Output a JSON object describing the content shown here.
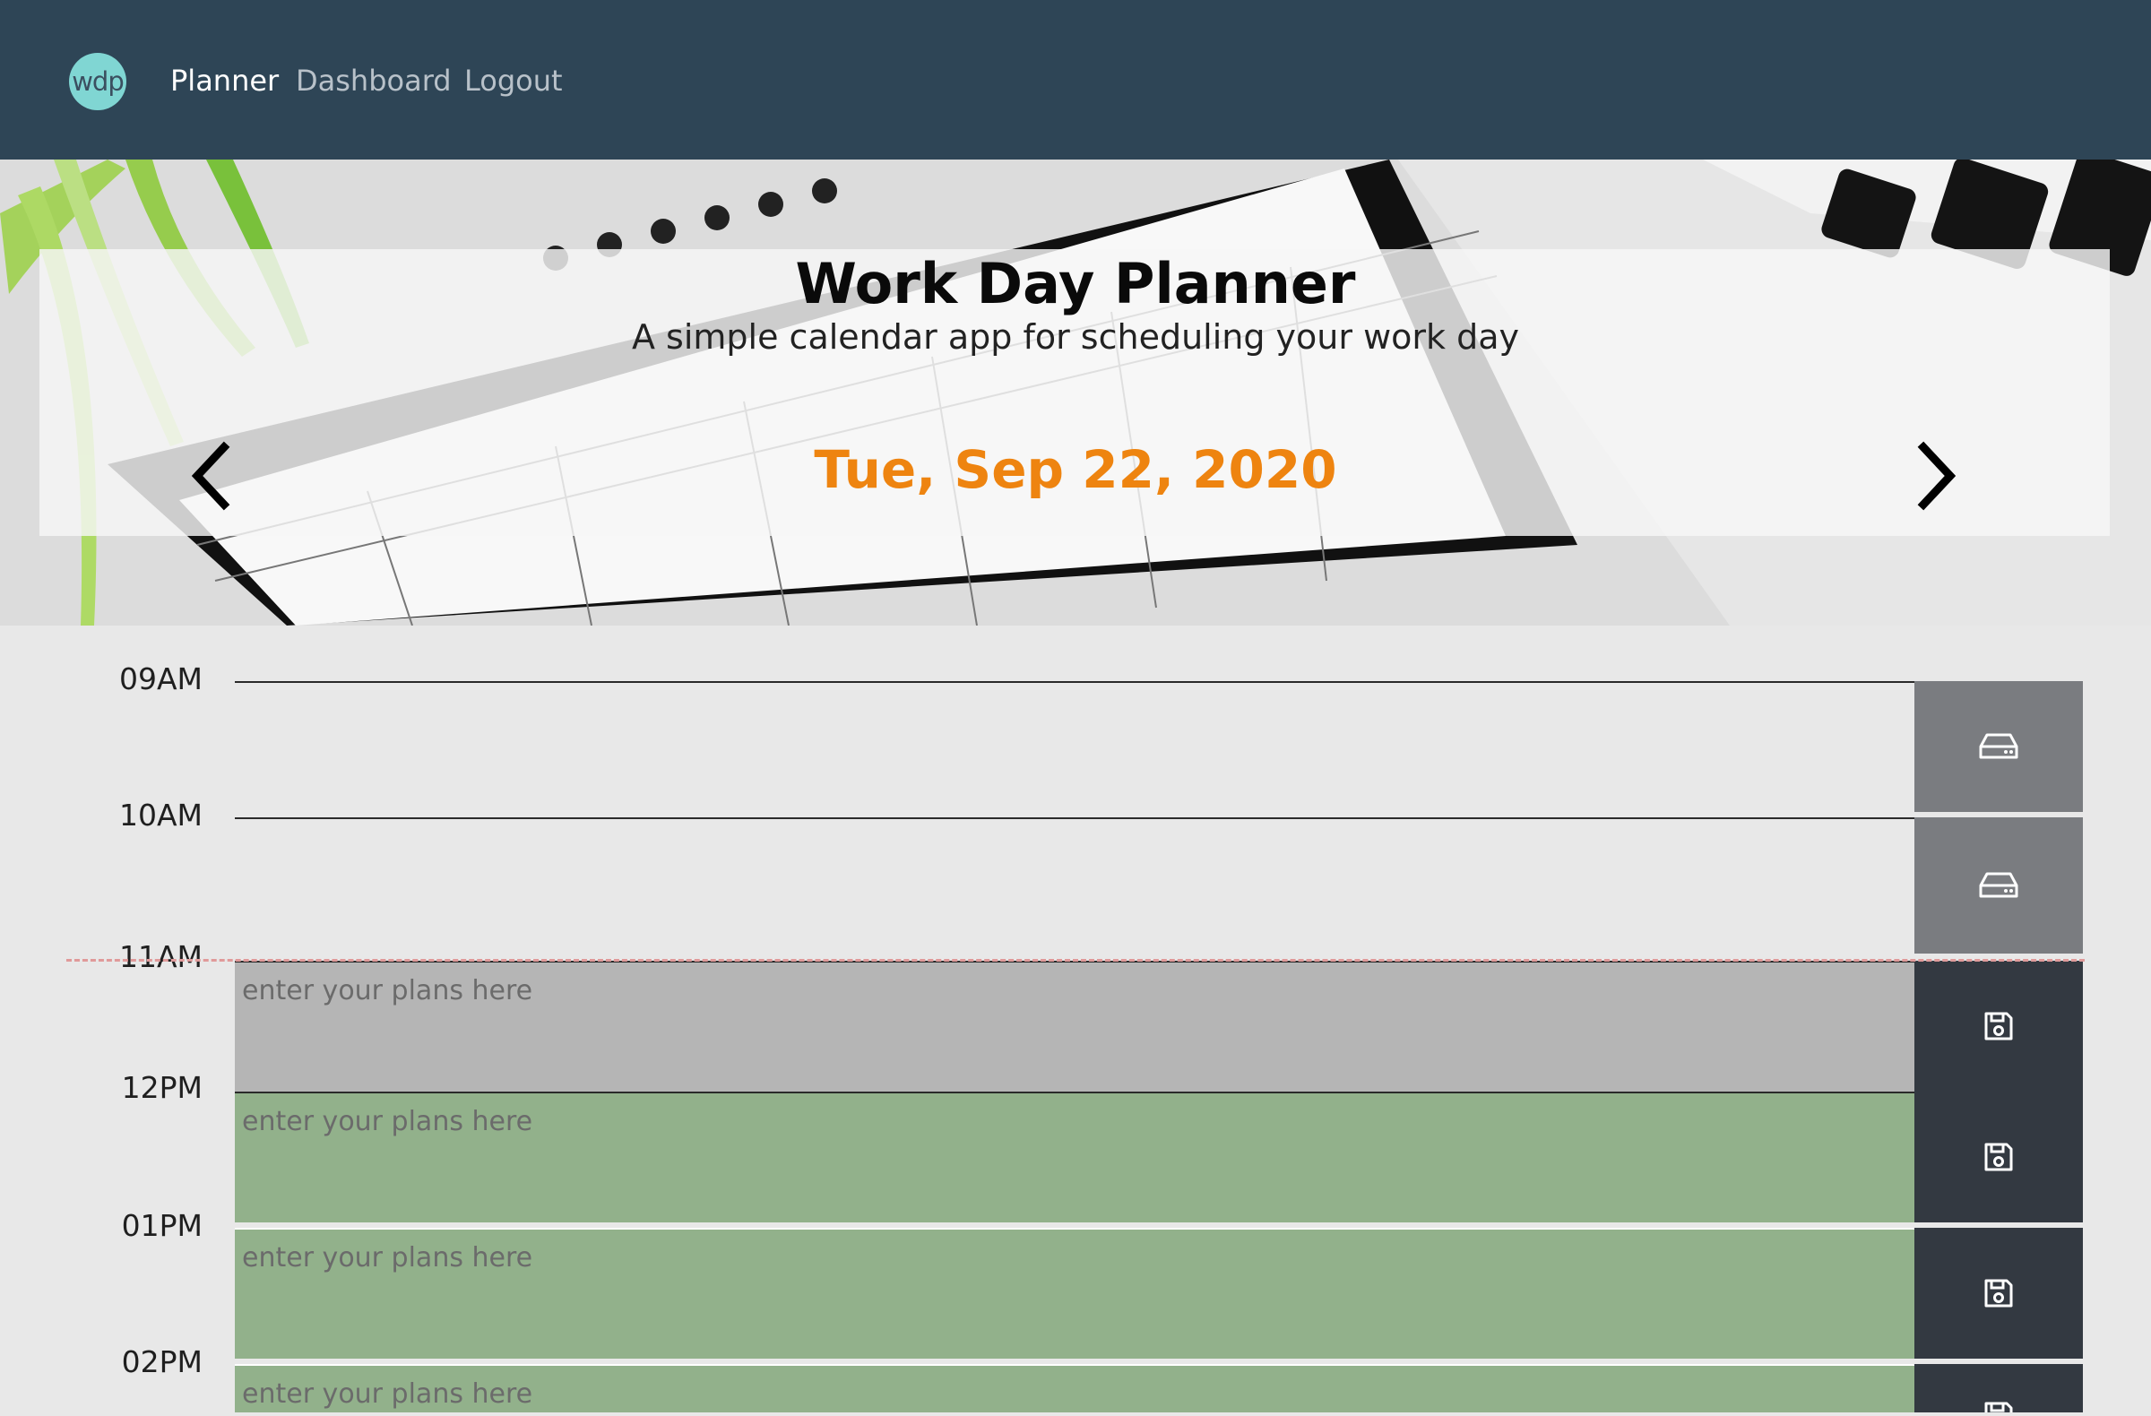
{
  "navbar": {
    "logo_text": "wdp",
    "links": [
      {
        "label": "Planner",
        "active": true
      },
      {
        "label": "Dashboard",
        "active": false
      },
      {
        "label": "Logout",
        "active": false
      }
    ],
    "background": "#2e4556"
  },
  "hero": {
    "title": "Work Day Planner",
    "subtitle": "A simple calendar app for scheduling your work day",
    "date": "Tue, Sep 22, 2020",
    "date_color": "#ee8410",
    "prev_icon": "chevron-left-icon",
    "next_icon": "chevron-right-icon"
  },
  "schedule": {
    "placeholder": "enter your plans here",
    "rows": [
      {
        "hour": "09AM",
        "state": "past",
        "save_icon": "hard-drive-icon"
      },
      {
        "hour": "10AM",
        "state": "past",
        "save_icon": "hard-drive-icon"
      },
      {
        "hour": "11AM",
        "state": "present",
        "save_icon": "floppy-disk-icon"
      },
      {
        "hour": "12PM",
        "state": "future",
        "save_icon": "floppy-disk-icon"
      },
      {
        "hour": "01PM",
        "state": "future",
        "save_icon": "floppy-disk-icon"
      },
      {
        "hour": "02PM",
        "state": "future",
        "save_icon": "floppy-disk-icon"
      }
    ],
    "colors": {
      "present": "#b5b5b5",
      "future": "#92b18b",
      "save_active": "#333941",
      "save_past": "#7a7c80"
    }
  }
}
